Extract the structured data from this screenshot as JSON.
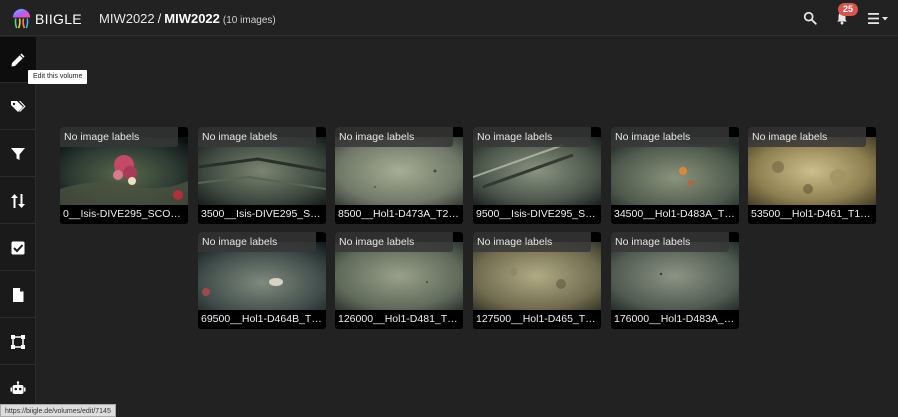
{
  "app": {
    "brand": "BIIGLE"
  },
  "breadcrumb": {
    "project": "MIW2022",
    "separator": "/",
    "volume": "MIW2022",
    "count": "(10 images)"
  },
  "navbar": {
    "notification_count": "25",
    "icons": [
      "search-icon",
      "bell-icon",
      "menu-icon"
    ]
  },
  "sidebar": {
    "items": [
      {
        "name": "edit",
        "icon": "pencil-icon",
        "active": true
      },
      {
        "name": "labels",
        "icon": "tags-icon"
      },
      {
        "name": "filter",
        "icon": "filter-icon"
      },
      {
        "name": "sort",
        "icon": "sort-icon"
      },
      {
        "name": "select",
        "icon": "checkbox-icon"
      },
      {
        "name": "reports",
        "icon": "file-icon"
      },
      {
        "name": "annotation",
        "icon": "vector-square-icon"
      },
      {
        "name": "automation",
        "icon": "robot-icon"
      }
    ]
  },
  "tooltip": "Edit this volume",
  "status_url": "https://biigle.de/volumes/edit/7145",
  "images": [
    {
      "label": "No image labels",
      "filename": "0__Isis-DIVE295_SCO…"
    },
    {
      "label": "No image labels",
      "filename": "3500__Isis-DIVE295_S…"
    },
    {
      "label": "No image labels",
      "filename": "8500__Hol1-D473A_T2…"
    },
    {
      "label": "No image labels",
      "filename": "9500__Isis-DIVE295_S…"
    },
    {
      "label": "No image labels",
      "filename": "34500__Hol1-D483A_T…"
    },
    {
      "label": "No image labels",
      "filename": "53500__Hol1-D461_T1…"
    },
    {
      "label": "No image labels",
      "filename": "69500__Hol1-D464B_T…"
    },
    {
      "label": "No image labels",
      "filename": "126000__Hol1-D481_T…"
    },
    {
      "label": "No image labels",
      "filename": "127500__Hol1-D465_T…"
    },
    {
      "label": "No image labels",
      "filename": "176000__Hol1-D483A_…"
    }
  ],
  "colors": {
    "background": "#222222",
    "sidebar": "#1a1a1a",
    "badge": "#d9534f"
  }
}
